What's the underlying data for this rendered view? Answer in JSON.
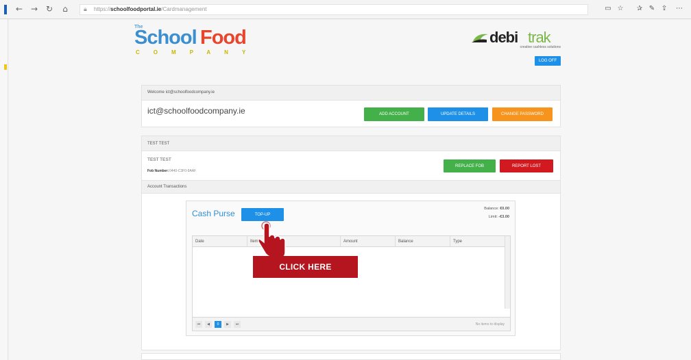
{
  "browser": {
    "url_prefix": "https://",
    "url_domain": "schoolfoodportal.ie",
    "url_path": "/Cardmanagement",
    "icons": [
      "back-icon",
      "forward-icon",
      "refresh-icon",
      "home-icon",
      "lock-icon",
      "reading-view-icon",
      "favorite-icon",
      "favorites-hub-icon",
      "pen-icon",
      "share-icon",
      "more-icon"
    ]
  },
  "logos": {
    "sfc_the": "The",
    "sfc_school": "School",
    "sfc_food": "Food",
    "sfc_company": "COMPANY",
    "debi": "debi",
    "trak": "trak",
    "debitrak_tagline": "creative cashless solutions"
  },
  "header": {
    "logoff_label": "LOG OFF"
  },
  "account_panel": {
    "welcome": "Welcome ict@schoolfoodcompany.ie",
    "email": "ict@schoolfoodcompany.ie",
    "add_account": "ADD ACCOUNT",
    "update_details": "UPDATE DETAILS",
    "change_password": "CHANGE PASSWORD"
  },
  "card_panel": {
    "title": "TEST TEST",
    "name": "TEST TEST",
    "fob_label": "Fob Number:",
    "fob_value": "0440-C3F0-9AAF",
    "replace_fob": "REPLACE FOB",
    "report_lost": "REPORT LOST",
    "transactions_header": "Account Transactions"
  },
  "purse": {
    "title": "Cash Purse",
    "topup_label": "TOP-UP",
    "balance_label": "Balance:",
    "balance_value": "€0.00",
    "limit_label": "Limit:",
    "limit_value": "-€3.00",
    "columns": [
      "Date",
      "Item",
      "Amount",
      "Balance",
      "Type"
    ],
    "pager": [
      "⏮",
      "◀",
      "0",
      "▶",
      "⏭"
    ],
    "no_items": "No items to display"
  },
  "callout": {
    "label": "CLICK HERE"
  },
  "colors": {
    "blue": "#1e90e8",
    "green": "#43b04a",
    "orange": "#f7941d",
    "red": "#d31920",
    "callout": "#b4151f"
  }
}
